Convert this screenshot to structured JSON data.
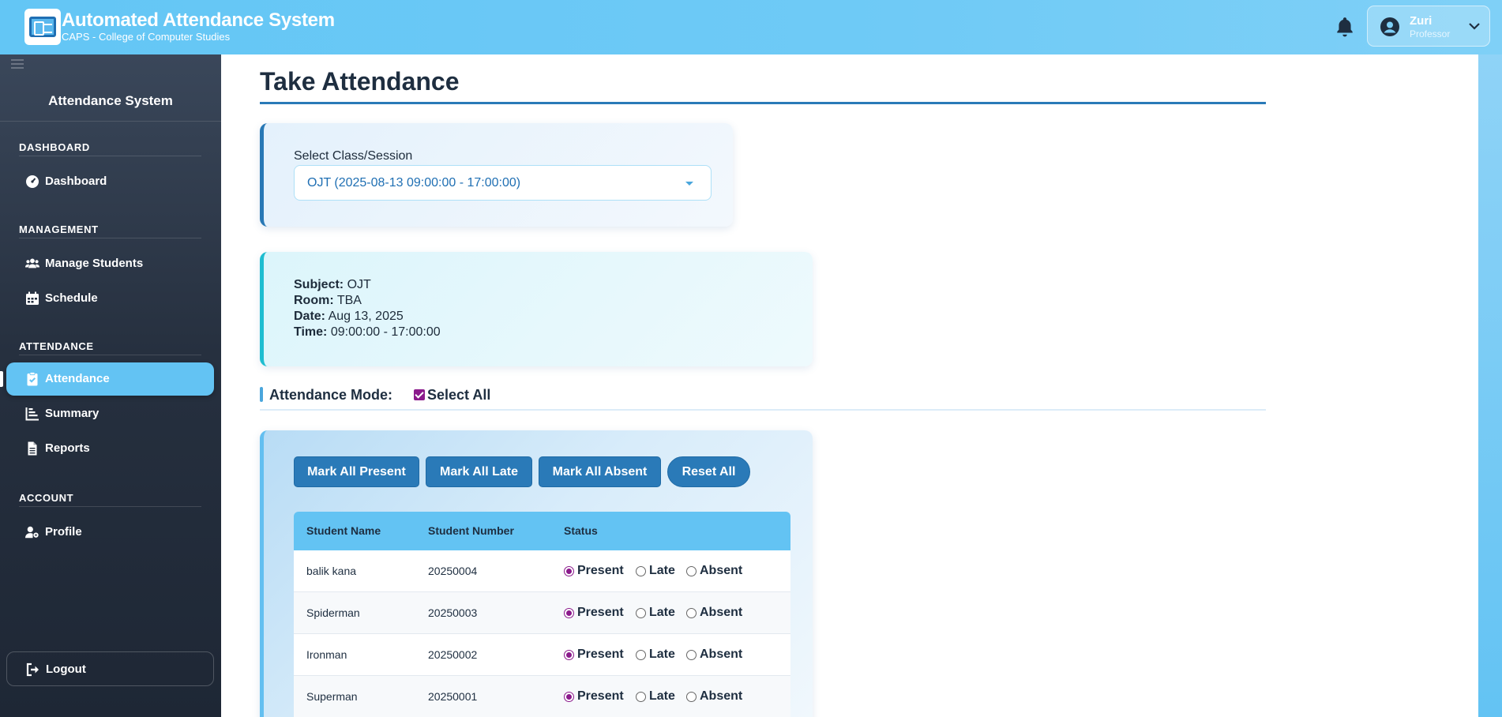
{
  "header": {
    "title": "Automated Attendance System",
    "subtitle": "CAPS - College of Computer Studies",
    "user": {
      "name": "Zuri",
      "role": "Professor"
    }
  },
  "sidebar": {
    "title": "Attendance System",
    "sections": {
      "dashboard": "DASHBOARD",
      "management": "MANAGEMENT",
      "attendance": "ATTENDANCE",
      "account": "ACCOUNT"
    },
    "items": {
      "dashboard": "Dashboard",
      "students": "Manage Students",
      "schedule": "Schedule",
      "attendance": "Attendance",
      "summary": "Summary",
      "reports": "Reports",
      "profile": "Profile"
    },
    "active": "Attendance",
    "logout": "Logout"
  },
  "page": {
    "title": "Take Attendance",
    "select_label": "Select Class/Session",
    "selected_session": "OJT (2025-08-13 09:00:00 - 17:00:00)",
    "info": {
      "subject_label": "Subject:",
      "subject": "OJT",
      "room_label": "Room:",
      "room": "TBA",
      "date_label": "Date:",
      "date": "Aug 13, 2025",
      "time_label": "Time:",
      "time": "09:00:00 - 17:00:00"
    },
    "mode_label": "Attendance Mode:",
    "select_all_label": "Select All",
    "select_all_checked": true,
    "buttons": {
      "present": "Mark All Present",
      "late": "Mark All Late",
      "absent": "Mark All Absent",
      "reset": "Reset All"
    },
    "table": {
      "headers": [
        "Student Name",
        "Student Number",
        "Status"
      ],
      "status_options": [
        "Present",
        "Late",
        "Absent"
      ],
      "rows": [
        {
          "name": "balik kana",
          "number": "20250004",
          "status": "Present"
        },
        {
          "name": "Spiderman",
          "number": "20250003",
          "status": "Present"
        },
        {
          "name": "Ironman",
          "number": "20250002",
          "status": "Present"
        },
        {
          "name": "Superman",
          "number": "20250001",
          "status": "Present"
        }
      ]
    }
  },
  "colors": {
    "topbar": "#63c6f5",
    "sidebar": "#26303f",
    "accent": "#2a7ab8",
    "active_nav": "#63c3f3",
    "radio_selected": "#8b1a8c"
  }
}
